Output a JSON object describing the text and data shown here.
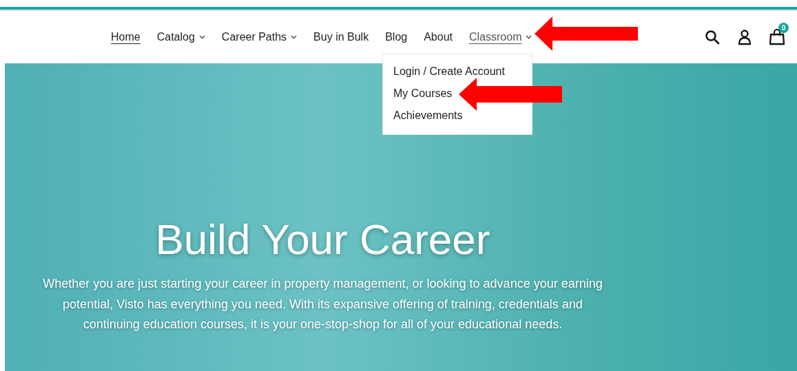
{
  "nav": {
    "items": [
      {
        "label": "Home",
        "selected": true,
        "dropdown": false,
        "expanded": false
      },
      {
        "label": "Catalog",
        "selected": false,
        "dropdown": true,
        "expanded": false
      },
      {
        "label": "Career Paths",
        "selected": false,
        "dropdown": true,
        "expanded": false
      },
      {
        "label": "Buy in Bulk",
        "selected": false,
        "dropdown": false,
        "expanded": false
      },
      {
        "label": "Blog",
        "selected": false,
        "dropdown": false,
        "expanded": false
      },
      {
        "label": "About",
        "selected": false,
        "dropdown": false,
        "expanded": false
      },
      {
        "label": "Classroom",
        "selected": false,
        "dropdown": true,
        "expanded": true
      }
    ]
  },
  "dropdown_menu": {
    "items": [
      "Login / Create Account",
      "My Courses",
      "Achievements"
    ]
  },
  "cart": {
    "count": "0"
  },
  "hero": {
    "title": "Build Your Career",
    "text": "Whether you are just starting your career in property management, or looking to advance your earning potential, Visto has everything you need. With its expansive offering of training, credentials and continuing education courses, it is your one-stop-shop for all of your educational needs."
  }
}
